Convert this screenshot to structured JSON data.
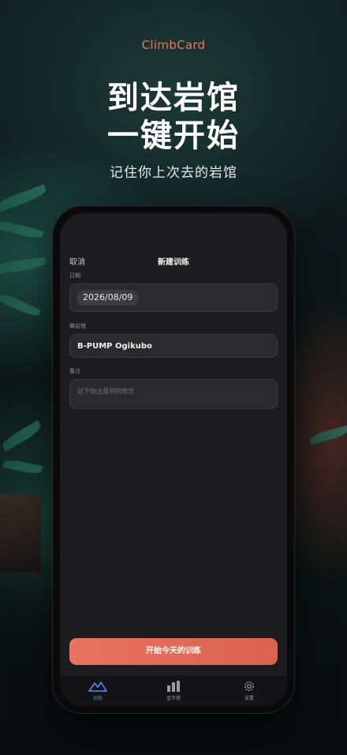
{
  "promo": {
    "brand": "ClimbCard",
    "headline_line1": "到达岩馆",
    "headline_line2": "一键开始",
    "subline": "记住你上次去的岩馆"
  },
  "screen": {
    "nav": {
      "cancel_label": "取消",
      "title": "新建训练"
    },
    "date": {
      "label": "日期",
      "value": "2026/08/09"
    },
    "gym": {
      "label": "攀岩馆",
      "value": "B-PUMP Ogikubo"
    },
    "note": {
      "label": "备注",
      "placeholder": "记下你注意到的地方"
    },
    "start_button_label": "开始今天的训练",
    "tabbar": {
      "items": [
        {
          "label": "训练",
          "icon": "mountain-icon",
          "active": true
        },
        {
          "label": "金字塔",
          "icon": "bar-chart-icon",
          "active": false
        },
        {
          "label": "设置",
          "icon": "gear-icon",
          "active": false
        }
      ]
    }
  },
  "colors": {
    "brand": "#e27a63",
    "cta": "#e06b56",
    "active_tab": "#5b8cff"
  }
}
